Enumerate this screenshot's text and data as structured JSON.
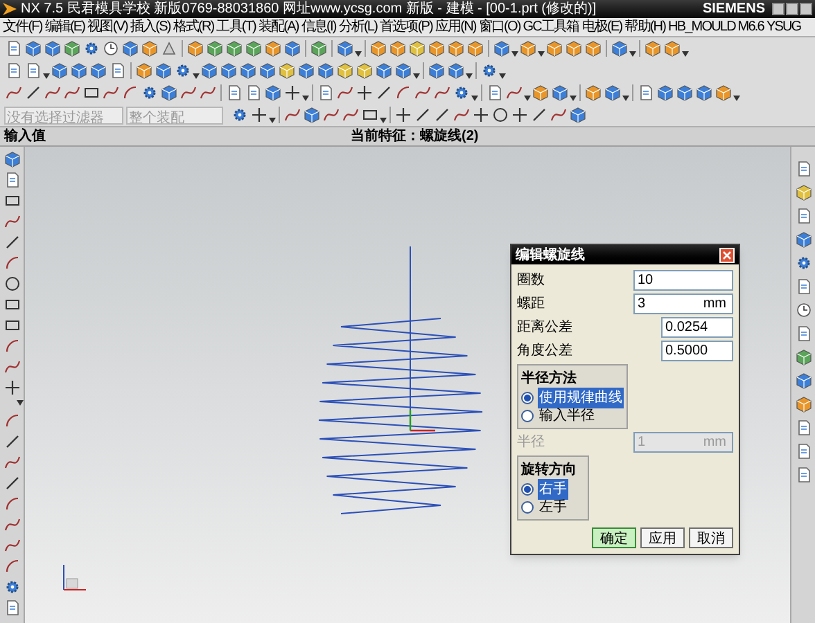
{
  "window": {
    "title": "NX 7.5 民君模具学校 新版0769-88031860 网址www.ycsg.com 新版 - 建模 - [00-1.prt (修改的)]",
    "brand": "SIEMENS"
  },
  "menu": [
    "文件(F)",
    "编辑(E)",
    "视图(V)",
    "插入(S)",
    "格式(R)",
    "工具(T)",
    "装配(A)",
    "信息(I)",
    "分析(L)",
    "首选项(P)",
    "应用(N)",
    "窗口(O)",
    "GC工具箱",
    "电极(E)",
    "帮助(H)",
    "HB_MOULD M6.6",
    "YSUG"
  ],
  "selection_bar": {
    "filter": "没有选择过滤器",
    "scope": "整个装配"
  },
  "status": {
    "prompt": "输入值",
    "current_feature": "当前特征：螺旋线(2)"
  },
  "dialog": {
    "title": "编辑螺旋线",
    "turns": {
      "label": "圈数",
      "value": "10"
    },
    "pitch": {
      "label": "螺距",
      "value": "3",
      "unit": "mm"
    },
    "distance_tolerance": {
      "label": "距离公差",
      "value": "0.0254"
    },
    "angle_tolerance": {
      "label": "角度公差",
      "value": "0.5000"
    },
    "radius_method": {
      "label": "半径方法",
      "options": [
        {
          "label": "使用规律曲线",
          "selected": true
        },
        {
          "label": "输入半径",
          "selected": false
        }
      ]
    },
    "radius": {
      "label": "半径",
      "value": "1",
      "unit": "mm",
      "disabled": true
    },
    "turn_direction": {
      "label": "旋转方向",
      "options": [
        {
          "label": "右手",
          "selected": true
        },
        {
          "label": "左手",
          "selected": false
        }
      ]
    },
    "buttons": [
      {
        "label": "确定",
        "default": true
      },
      {
        "label": "应用",
        "default": false
      },
      {
        "label": "取消",
        "default": false
      }
    ]
  }
}
